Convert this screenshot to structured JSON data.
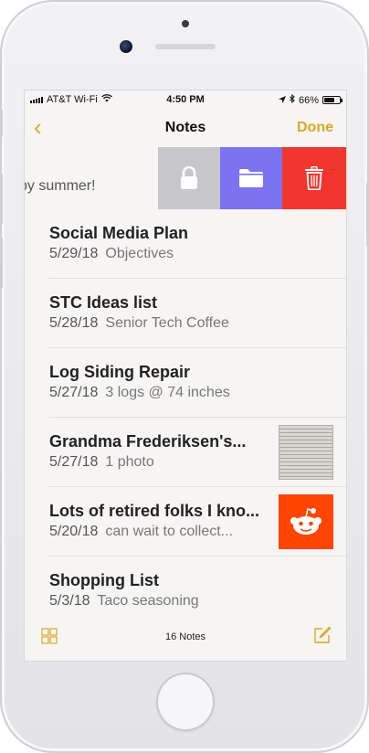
{
  "status_bar": {
    "carrier": "AT&T Wi-Fi",
    "time": "4:50 PM",
    "battery": "66%",
    "battery_level": 0.66,
    "icons": [
      "signal-icon",
      "wifi-icon",
      "location-icon",
      "bluetooth-icon",
      "battery-icon"
    ]
  },
  "nav": {
    "back": "‹",
    "title": "Notes",
    "done": "Done"
  },
  "swiped_row": {
    "partial_text": "by summer!",
    "actions": [
      "lock-icon",
      "folder-icon",
      "trash-icon"
    ]
  },
  "notes": [
    {
      "title": "Social Media Plan",
      "date": "5/29/18",
      "preview": "Objectives",
      "thumbnail": ""
    },
    {
      "title": "STC Ideas list",
      "date": "5/28/18",
      "preview": "Senior Tech Coffee",
      "thumbnail": ""
    },
    {
      "title": "Log Siding Repair",
      "date": "5/27/18",
      "preview": "3 logs @ 74 inches",
      "thumbnail": ""
    },
    {
      "title": "Grandma Frederiksen's...",
      "date": "5/27/18",
      "preview": "1 photo",
      "thumbnail": "document-photo"
    },
    {
      "title": "Lots of retired folks I kno...",
      "date": "5/20/18",
      "preview": "can wait to collect...",
      "thumbnail": "reddit-logo"
    },
    {
      "title": "Shopping List",
      "date": "5/3/18",
      "preview": "Taco seasoning",
      "thumbnail": ""
    }
  ],
  "bottom_bar": {
    "count": "16 Notes",
    "icons": [
      "gallery-view-icon",
      "compose-icon"
    ]
  },
  "colors": {
    "accent": "#d9a822",
    "lock": "#c7c6cb",
    "move": "#7b73f2",
    "delete": "#f2352e",
    "reddit": "#ff4500"
  }
}
